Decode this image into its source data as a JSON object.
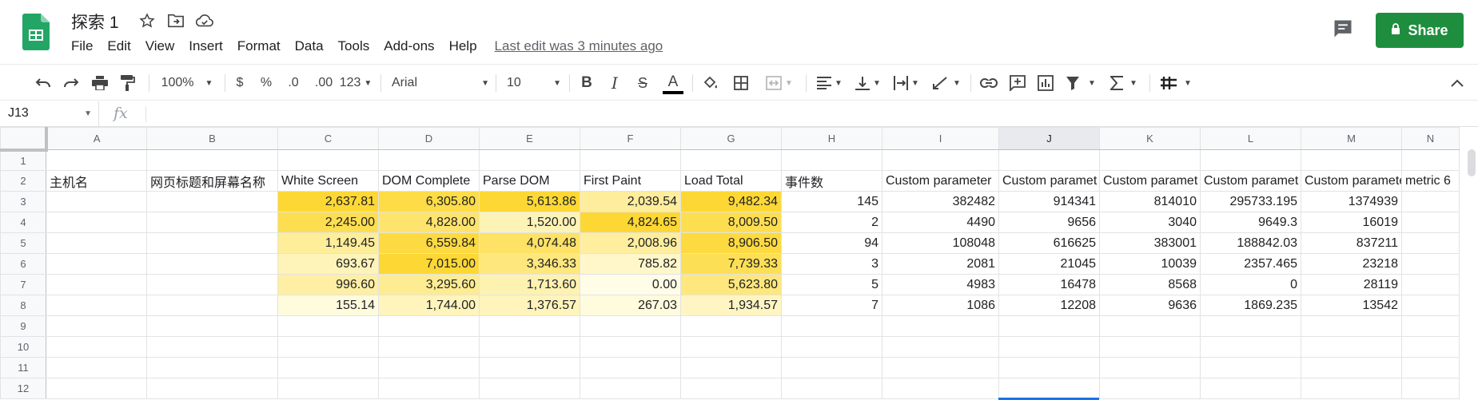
{
  "doc": {
    "title": "探索 1"
  },
  "menu": {
    "items": [
      "File",
      "Edit",
      "View",
      "Insert",
      "Format",
      "Data",
      "Tools",
      "Add-ons",
      "Help"
    ],
    "last_edit": "Last edit was 3 minutes ago"
  },
  "share": {
    "label": "Share"
  },
  "toolbar": {
    "zoom": "100%",
    "currency": "$",
    "percent": "%",
    "dec_decrease": ".0",
    "dec_increase": ".00",
    "more_formats": "123",
    "font": "Arial",
    "font_size": "10",
    "bold": "B",
    "italic": "I",
    "strike": "S",
    "text_color_glyph": "A"
  },
  "formula_bar": {
    "cell_ref": "J13",
    "fx": "fx",
    "value": ""
  },
  "colors": {
    "brand_green": "#1e8e3e",
    "selection_blue": "#1a73e8",
    "scale_min": "#fffde7",
    "scale_max": "#fdd835"
  },
  "columns": [
    "A",
    "B",
    "C",
    "D",
    "E",
    "F",
    "G",
    "H",
    "I",
    "J",
    "K",
    "L",
    "M",
    "N"
  ],
  "selected_column": "J",
  "rows": [
    [
      "",
      "",
      "",
      "",
      "",
      "",
      "",
      "",
      "",
      "",
      "",
      "",
      "",
      ""
    ],
    [
      "主机名",
      "网页标题和屏幕名称",
      "White Screen",
      "DOM Complete",
      "Parse DOM",
      "First Paint",
      "Load Total",
      "事件数",
      "Custom parameter",
      "Custom paramet",
      "Custom paramet",
      "Custom paramet",
      "Custom parameter",
      "metric 6"
    ],
    [
      "",
      "",
      "2,637.81",
      "6,305.80",
      "5,613.86",
      "2,039.54",
      "9,482.34",
      "145",
      "382482",
      "914341",
      "814010",
      "295733.195",
      "1374939",
      ""
    ],
    [
      "",
      "",
      "2,245.00",
      "4,828.00",
      "1,520.00",
      "4,824.65",
      "8,009.50",
      "2",
      "4490",
      "9656",
      "3040",
      "9649.3",
      "16019",
      ""
    ],
    [
      "",
      "",
      "1,149.45",
      "6,559.84",
      "4,074.48",
      "2,008.96",
      "8,906.50",
      "94",
      "108048",
      "616625",
      "383001",
      "188842.03",
      "837211",
      ""
    ],
    [
      "",
      "",
      "693.67",
      "7,015.00",
      "3,346.33",
      "785.82",
      "7,739.33",
      "3",
      "2081",
      "21045",
      "10039",
      "2357.465",
      "23218",
      ""
    ],
    [
      "",
      "",
      "996.60",
      "3,295.60",
      "1,713.60",
      "0.00",
      "5,623.80",
      "5",
      "4983",
      "16478",
      "8568",
      "0",
      "28119",
      ""
    ],
    [
      "",
      "",
      "155.14",
      "1,744.00",
      "1,376.57",
      "267.03",
      "1,934.57",
      "7",
      "1086",
      "12208",
      "9636",
      "1869.235",
      "13542",
      ""
    ],
    [
      "",
      "",
      "",
      "",
      "",
      "",
      "",
      "",
      "",
      "",
      "",
      "",
      "",
      ""
    ],
    [
      "",
      "",
      "",
      "",
      "",
      "",
      "",
      "",
      "",
      "",
      "",
      "",
      "",
      ""
    ],
    [
      "",
      "",
      "",
      "",
      "",
      "",
      "",
      "",
      "",
      "",
      "",
      "",
      "",
      ""
    ],
    [
      "",
      "",
      "",
      "",
      "",
      "",
      "",
      "",
      "",
      "",
      "",
      "",
      "",
      ""
    ]
  ]
}
